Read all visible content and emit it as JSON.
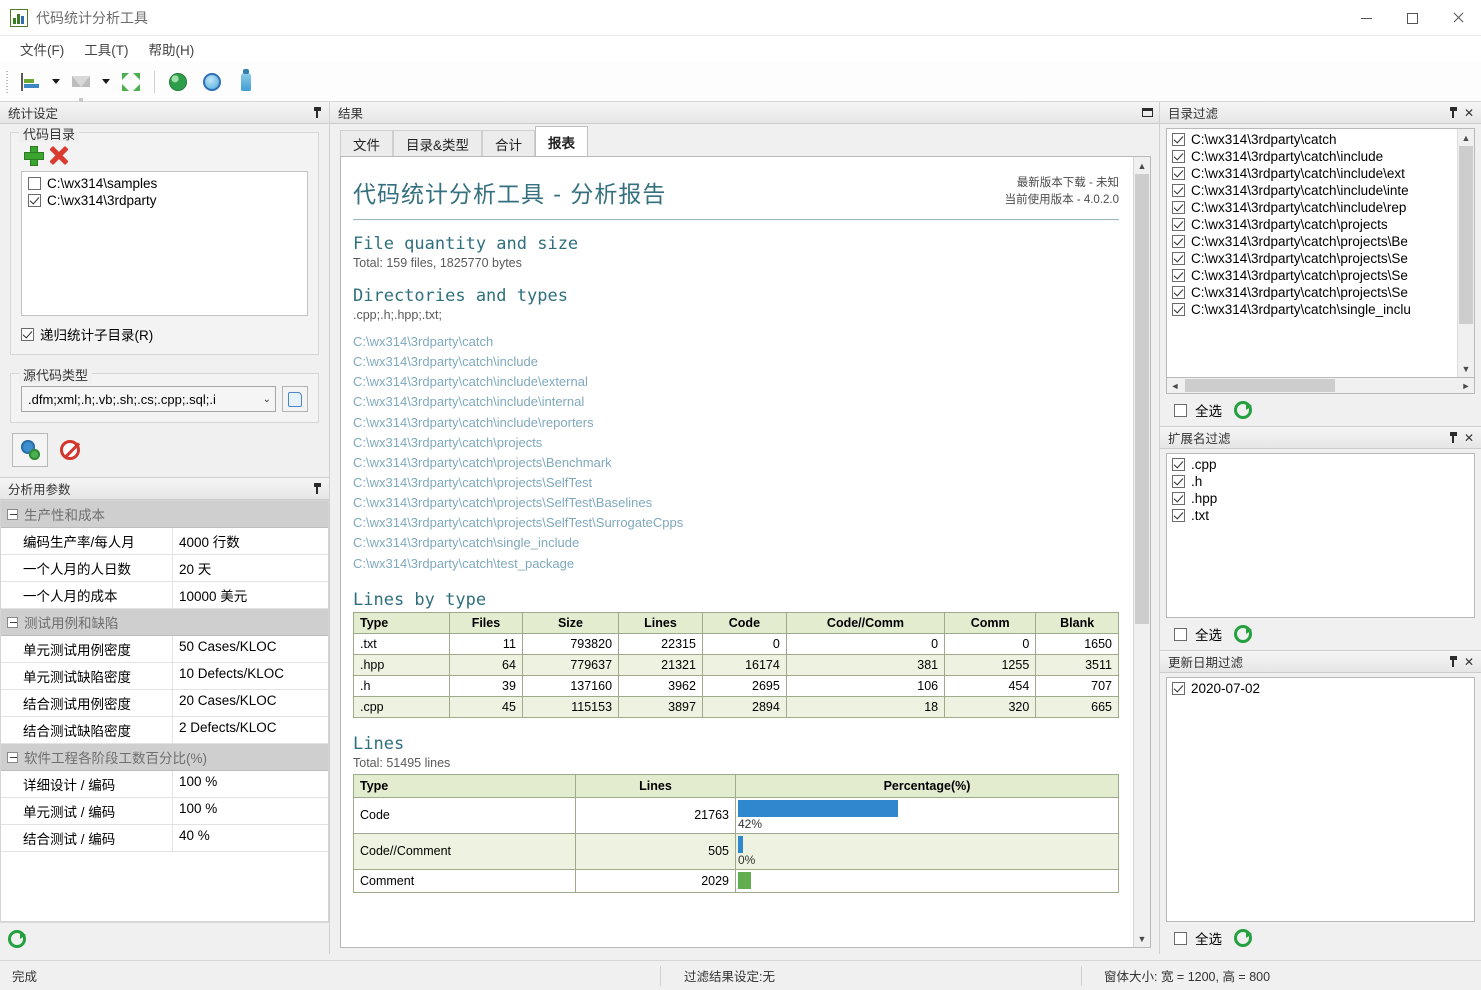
{
  "window": {
    "title": "代码统计分析工具",
    "app_icon": "chart-icon",
    "minimize": "–",
    "maximize": "□",
    "close": "✕"
  },
  "menubar": {
    "items": [
      "文件(F)",
      "工具(T)",
      "帮助(H)"
    ]
  },
  "toolbar": {
    "buttons": [
      {
        "name": "statistics-icon",
        "glyph": "bars"
      },
      {
        "name": "statistics-dropdown",
        "glyph": "caret"
      },
      {
        "name": "filter-icon",
        "glyph": "funnel"
      },
      {
        "name": "filter-dropdown",
        "glyph": "caret"
      },
      {
        "name": "expand-icon",
        "glyph": "expand"
      },
      {
        "name": "globe-icon",
        "glyph": "globe"
      },
      {
        "name": "refresh-icon",
        "glyph": "sync"
      },
      {
        "name": "export-icon",
        "glyph": "bottle"
      }
    ]
  },
  "left_panel": {
    "title": "统计设定",
    "code_dir_group": "代码目录",
    "add_label": "+",
    "remove_label": "✕",
    "dirs": [
      {
        "label": "C:\\wx314\\samples",
        "checked": false
      },
      {
        "label": "C:\\wx314\\3rdparty",
        "checked": true
      }
    ],
    "recursive": {
      "label": "递归统计子目录(R)",
      "checked": true
    },
    "source_type_group": "源代码类型",
    "source_type_value": ".dfm;xml;.h;.vb;.sh;.cs;.cpp;.sql;.i",
    "browse_icon": "scroll-icon",
    "run_button": "gear-icon",
    "stop_button": "ban-icon"
  },
  "params_panel": {
    "title": "分析用参数",
    "groups": [
      {
        "name": "生产性和成本",
        "rows": [
          {
            "key": "编码生产率/每人月",
            "value": "4000 行数"
          },
          {
            "key": "一个人月的人日数",
            "value": "20 天"
          },
          {
            "key": "一个人月的成本",
            "value": "10000 美元"
          }
        ]
      },
      {
        "name": "测试用例和缺陷",
        "rows": [
          {
            "key": "单元测试用例密度",
            "value": "50 Cases/KLOC"
          },
          {
            "key": "单元测试缺陷密度",
            "value": "10 Defects/KLOC"
          },
          {
            "key": "结合测试用例密度",
            "value": "20 Cases/KLOC"
          },
          {
            "key": "结合测试缺陷密度",
            "value": "2 Defects/KLOC"
          }
        ]
      },
      {
        "name": "软件工程各阶段工数百分比(%)",
        "rows": [
          {
            "key": "详细设计 / 编码",
            "value": "100 %"
          },
          {
            "key": "单元测试 / 编码",
            "value": "100 %"
          },
          {
            "key": "结合测试 / 编码",
            "value": "40 %"
          }
        ]
      }
    ]
  },
  "center_panel": {
    "title": "结果",
    "tabs": [
      {
        "label": "文件",
        "active": false
      },
      {
        "label": "目录&类型",
        "active": false
      },
      {
        "label": "合计",
        "active": false
      },
      {
        "label": "报表",
        "active": true
      }
    ]
  },
  "report": {
    "title": "代码统计分析工具 - 分析报告",
    "version_latest": "最新版本下载 - 未知",
    "version_current": "当前使用版本 - 4.0.2.0",
    "section_files": "File quantity and size",
    "files_total": "Total: 159 files, 1825770 bytes",
    "section_dirs": "Directories and types",
    "types_line": ".cpp;.h;.hpp;.txt;",
    "dir_list": [
      "C:\\wx314\\3rdparty\\catch",
      "C:\\wx314\\3rdparty\\catch\\include",
      "C:\\wx314\\3rdparty\\catch\\include\\external",
      "C:\\wx314\\3rdparty\\catch\\include\\internal",
      "C:\\wx314\\3rdparty\\catch\\include\\reporters",
      "C:\\wx314\\3rdparty\\catch\\projects",
      "C:\\wx314\\3rdparty\\catch\\projects\\Benchmark",
      "C:\\wx314\\3rdparty\\catch\\projects\\SelfTest",
      "C:\\wx314\\3rdparty\\catch\\projects\\SelfTest\\Baselines",
      "C:\\wx314\\3rdparty\\catch\\projects\\SelfTest\\SurrogateCpps",
      "C:\\wx314\\3rdparty\\catch\\single_include",
      "C:\\wx314\\3rdparty\\catch\\test_package"
    ],
    "section_lines_by_type": "Lines by type",
    "section_lines": "Lines",
    "lines_total": "Total: 51495 lines"
  },
  "chart_data": [
    {
      "type": "table",
      "title": "Lines by type",
      "columns": [
        "Type",
        "Files",
        "Size",
        "Lines",
        "Code",
        "Code//Comm",
        "Comm",
        "Blank"
      ],
      "rows": [
        [
          ".txt",
          "11",
          "793820",
          "22315",
          "0",
          "0",
          "0",
          "1650"
        ],
        [
          ".hpp",
          "64",
          "779637",
          "21321",
          "16174",
          "381",
          "1255",
          "3511"
        ],
        [
          ".h",
          "39",
          "137160",
          "3962",
          "2695",
          "106",
          "454",
          "707"
        ],
        [
          ".cpp",
          "45",
          "115153",
          "3897",
          "2894",
          "18",
          "320",
          "665"
        ]
      ]
    },
    {
      "type": "bar",
      "title": "Lines",
      "subtitle": "Total: 51495 lines",
      "columns": [
        "Type",
        "Lines",
        "Percentage(%)"
      ],
      "categories": [
        "Code",
        "Code//Comment",
        "Comment"
      ],
      "values": [
        21763,
        505,
        2029
      ],
      "percent_labels": [
        "42%",
        "0%",
        ""
      ],
      "percents": [
        42,
        1,
        4
      ],
      "bar_colors": [
        "#2f87ce",
        "#2f87ce",
        "#62ad4e"
      ],
      "xlabel": "",
      "ylabel": "Percentage(%)",
      "ylim": [
        0,
        100
      ]
    }
  ],
  "dir_filter": {
    "title": "目录过滤",
    "items": [
      "C:\\wx314\\3rdparty\\catch",
      "C:\\wx314\\3rdparty\\catch\\include",
      "C:\\wx314\\3rdparty\\catch\\include\\ext",
      "C:\\wx314\\3rdparty\\catch\\include\\inte",
      "C:\\wx314\\3rdparty\\catch\\include\\rep",
      "C:\\wx314\\3rdparty\\catch\\projects",
      "C:\\wx314\\3rdparty\\catch\\projects\\Be",
      "C:\\wx314\\3rdparty\\catch\\projects\\Se",
      "C:\\wx314\\3rdparty\\catch\\projects\\Se",
      "C:\\wx314\\3rdparty\\catch\\projects\\Se",
      "C:\\wx314\\3rdparty\\catch\\single_inclu"
    ],
    "select_all": "全选",
    "refresh": "refresh-icon"
  },
  "ext_filter": {
    "title": "扩展名过滤",
    "items": [
      ".cpp",
      ".h",
      ".hpp",
      ".txt"
    ],
    "select_all": "全选",
    "refresh": "refresh-icon"
  },
  "date_filter": {
    "title": "更新日期过滤",
    "items": [
      "2020-07-02"
    ],
    "select_all": "全选",
    "refresh": "refresh-icon"
  },
  "statusbar": {
    "state": "完成",
    "filter": "过滤结果设定:无",
    "size": "窗体大小: 宽 = 1200, 高 = 800"
  },
  "colors": {
    "accent_blue": "#2f87ce",
    "accent_green": "#62ad4e",
    "report_heading": "#2f6f7d",
    "table_header_bg": "#e4ecd0"
  }
}
